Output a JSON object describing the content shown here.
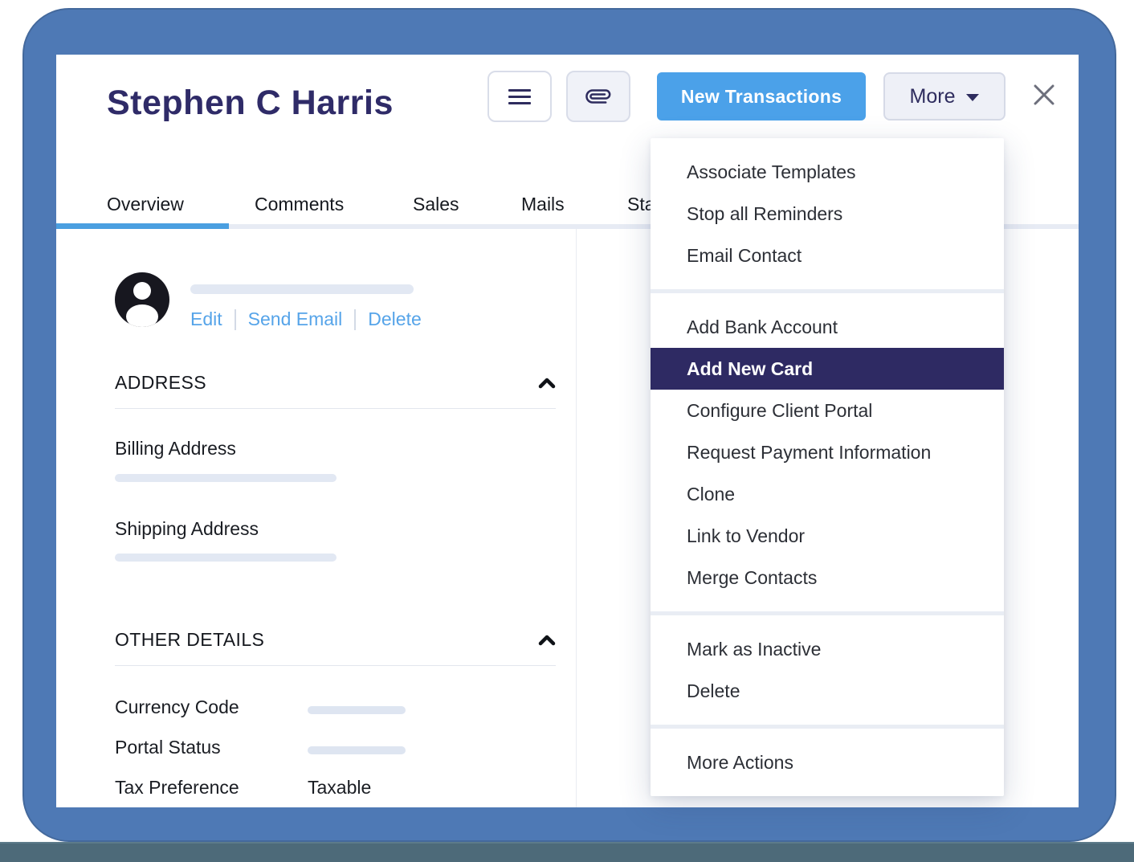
{
  "header": {
    "title": "Stephen C Harris",
    "new_transactions_label": "New Transactions",
    "more_label": "More"
  },
  "tabs": [
    {
      "label": "Overview",
      "active": true
    },
    {
      "label": "Comments",
      "active": false
    },
    {
      "label": "Sales",
      "active": false
    },
    {
      "label": "Mails",
      "active": false
    },
    {
      "label": "Sta",
      "active": false
    }
  ],
  "profile": {
    "actions": [
      {
        "label": "Edit"
      },
      {
        "label": "Send Email"
      },
      {
        "label": "Delete"
      }
    ]
  },
  "address_section": {
    "heading": "ADDRESS",
    "fields": [
      {
        "label": "Billing Address"
      },
      {
        "label": "Shipping Address"
      }
    ]
  },
  "other_details_section": {
    "heading": "OTHER DETAILS",
    "rows": [
      {
        "label": "Currency Code"
      },
      {
        "label": "Portal Status"
      },
      {
        "label": "Tax Preference",
        "value": "Taxable"
      }
    ]
  },
  "more_menu": {
    "groups": [
      {
        "items": [
          {
            "label": "Associate Templates"
          },
          {
            "label": "Stop all Reminders"
          },
          {
            "label": "Email Contact"
          }
        ]
      },
      {
        "items": [
          {
            "label": "Add Bank Account"
          },
          {
            "label": "Add New Card",
            "highlighted": true
          },
          {
            "label": "Configure Client Portal"
          },
          {
            "label": "Request Payment Information"
          },
          {
            "label": "Clone"
          },
          {
            "label": "Link to Vendor"
          },
          {
            "label": "Merge Contacts"
          }
        ]
      },
      {
        "items": [
          {
            "label": "Mark as Inactive"
          },
          {
            "label": "Delete"
          }
        ]
      },
      {
        "items": [
          {
            "label": "More Actions"
          }
        ]
      }
    ]
  },
  "colors": {
    "accent_blue": "#4a9fe0",
    "primary_button_blue": "#4ba1e9",
    "highlight_navy": "#2e2a63",
    "title_navy": "#2f2b68",
    "link_blue": "#56a4e9",
    "frame_blue": "#4e79b5",
    "desk_strip": "#4d6a79"
  }
}
